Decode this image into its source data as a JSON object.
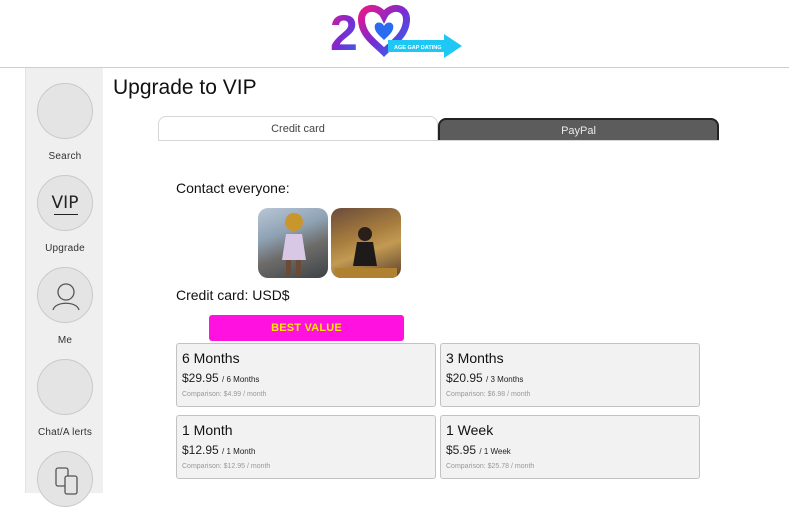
{
  "header": {
    "logo_text": "20",
    "logo_tagline": "AGE GAP DATING",
    "colors": {
      "pink": "#e8188c",
      "purple": "#7a2bd1",
      "blue": "#2a6cf0",
      "cyan": "#1fc7f5"
    }
  },
  "sidebar": {
    "items": [
      {
        "label": "Search",
        "icon": "search-icon"
      },
      {
        "label": "Upgrade",
        "icon": "vip-icon",
        "glyph": "VIP"
      },
      {
        "label": "Me",
        "icon": "user-icon"
      },
      {
        "label": "Chat/A lerts",
        "icon": "chat-icon"
      },
      {
        "label": "",
        "icon": "swap-phone-icon"
      }
    ]
  },
  "main": {
    "title": "Upgrade to VIP",
    "tabs": [
      {
        "label": "Credit card",
        "active": true
      },
      {
        "label": "PayPal",
        "active": false
      }
    ],
    "contact_label": "Contact everyone:",
    "currency_label": "Credit card: USD$",
    "best_value": "BEST VALUE",
    "plans": [
      {
        "name": "6 Months",
        "price": "$29.95",
        "per": "/ 6 Months",
        "comparison": "Comparison: $4.99 / month"
      },
      {
        "name": "3 Months",
        "price": "$20.95",
        "per": "/ 3 Months",
        "comparison": "Comparison: $6.98 / month"
      },
      {
        "name": "1 Month",
        "price": "$12.95",
        "per": "/ 1 Month",
        "comparison": "Comparison: $12.95 / month"
      },
      {
        "name": "1 Week",
        "price": "$5.95",
        "per": "/ 1 Week",
        "comparison": "Comparison: $25.78 / month"
      }
    ]
  }
}
